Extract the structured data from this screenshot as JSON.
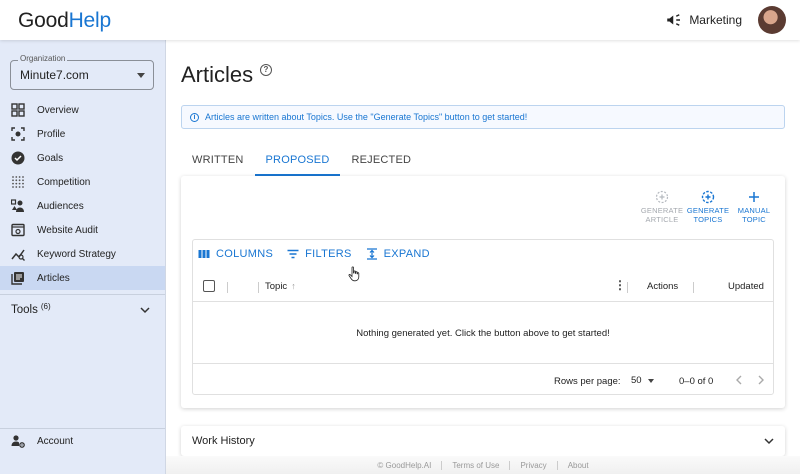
{
  "header": {
    "logo_good": "Good",
    "logo_help": "Help",
    "workspace": "Marketing"
  },
  "sidebar": {
    "org_label": "Organization",
    "org_value": "Minute7.com",
    "items": [
      {
        "label": "Overview",
        "icon": "grid-icon"
      },
      {
        "label": "Profile",
        "icon": "profile-focus-icon"
      },
      {
        "label": "Goals",
        "icon": "check-circle-icon"
      },
      {
        "label": "Competition",
        "icon": "dots-grid-icon"
      },
      {
        "label": "Audiences",
        "icon": "audience-icon"
      },
      {
        "label": "Website Audit",
        "icon": "website-audit-icon"
      },
      {
        "label": "Keyword Strategy",
        "icon": "keyword-chart-icon"
      },
      {
        "label": "Articles",
        "icon": "articles-icon",
        "active": true
      }
    ],
    "tools_label": "Tools",
    "tools_count": "(6)",
    "account_label": "Account"
  },
  "main": {
    "title": "Articles",
    "help_glyph": "?",
    "info_glyph": "i",
    "info_text": "Articles are written about Topics. Use the \"Generate Topics\" button to get started!",
    "tabs": [
      {
        "label": "WRITTEN",
        "active": false
      },
      {
        "label": "PROPOSED",
        "active": true
      },
      {
        "label": "REJECTED",
        "active": false
      }
    ],
    "actions": [
      {
        "line1": "GENERATE",
        "line2": "ARTICLE",
        "enabled": false
      },
      {
        "line1": "GENERATE",
        "line2": "TOPICS",
        "enabled": true
      },
      {
        "line1": "MANUAL",
        "line2": "TOPIC",
        "enabled": true
      }
    ],
    "grid": {
      "toolbar": {
        "columns": "COLUMNS",
        "filters": "FILTERS",
        "expand": "EXPAND"
      },
      "columns": {
        "topic": "Topic",
        "topic_sort_arrow": "↑",
        "menu_glyph": "⋮",
        "actions": "Actions",
        "updated": "Updated"
      },
      "empty_message": "Nothing generated yet. Click the button above to get started!",
      "footer": {
        "rows_per_page_label": "Rows per page:",
        "rows_per_page_value": "50",
        "range": "0–0 of 0"
      }
    },
    "work_history_label": "Work History"
  },
  "footer": {
    "copyright": "© GoodHelp.AI",
    "terms": "Terms of Use",
    "privacy": "Privacy",
    "about": "About"
  },
  "colors": {
    "accent": "#1976d2",
    "sidebar_bg": "#e3eaf8",
    "sidebar_active": "#c9d8f2",
    "disabled": "#a5a9af"
  }
}
